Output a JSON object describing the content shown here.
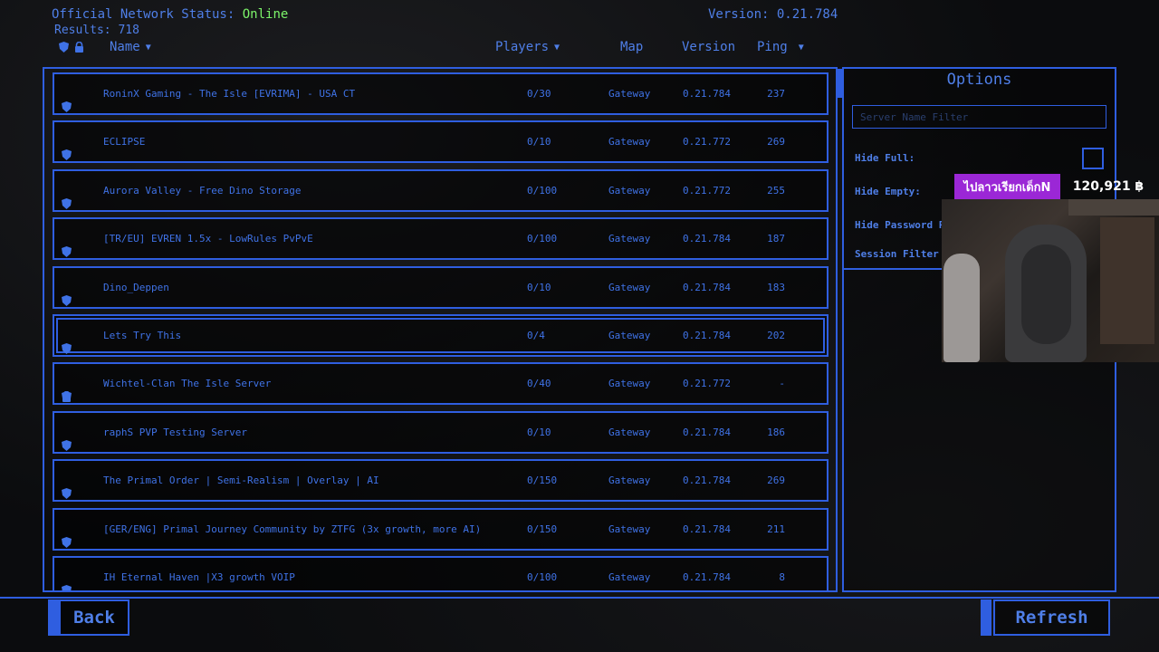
{
  "status": {
    "label": "Official Network Status:",
    "value": "Online",
    "results": "Results: 718",
    "version": "Version: 0.21.784"
  },
  "headers": {
    "name": "Name",
    "players": "Players",
    "map": "Map",
    "version": "Version",
    "ping": "Ping"
  },
  "servers": [
    {
      "name": "RoninX Gaming - The Isle [EVRIMA] - USA CT",
      "players": "0/30",
      "map": "Gateway",
      "version": "0.21.784",
      "ping": "237",
      "locked": false
    },
    {
      "name": "ECLIPSE",
      "players": "0/10",
      "map": "Gateway",
      "version": "0.21.772",
      "ping": "269",
      "locked": false
    },
    {
      "name": "Aurora Valley - Free Dino Storage",
      "players": "0/100",
      "map": "Gateway",
      "version": "0.21.772",
      "ping": "255",
      "locked": false
    },
    {
      "name": "[TR/EU] EVREN 1.5x - LowRules PvPvE",
      "players": "0/100",
      "map": "Gateway",
      "version": "0.21.784",
      "ping": "187",
      "locked": false
    },
    {
      "name": "Dino_Deppen",
      "players": "0/10",
      "map": "Gateway",
      "version": "0.21.784",
      "ping": "183",
      "locked": false
    },
    {
      "name": "Lets Try This",
      "players": "0/4",
      "map": "Gateway",
      "version": "0.21.784",
      "ping": "202",
      "locked": false
    },
    {
      "name": "Wichtel-Clan The Isle Server",
      "players": "0/40",
      "map": "Gateway",
      "version": "0.21.772",
      "ping": "-",
      "locked": true
    },
    {
      "name": "raphS PVP Testing Server",
      "players": "0/10",
      "map": "Gateway",
      "version": "0.21.784",
      "ping": "186",
      "locked": false
    },
    {
      "name": "The Primal Order | Semi-Realism | Overlay | AI",
      "players": "0/150",
      "map": "Gateway",
      "version": "0.21.784",
      "ping": "269",
      "locked": false
    },
    {
      "name": "[GER/ENG] Primal Journey Community by ZTFG (3x growth, more AI)",
      "players": "0/150",
      "map": "Gateway",
      "version": "0.21.784",
      "ping": "211",
      "locked": false
    },
    {
      "name": "IH Eternal Haven |X3 growth VOIP",
      "players": "0/100",
      "map": "Gateway",
      "version": "0.21.784",
      "ping": "8",
      "locked": false
    }
  ],
  "options": {
    "title": "Options",
    "filter_placeholder": "Server Name Filter",
    "hide_full": "Hide Full:",
    "hide_empty": "Hide Empty:",
    "hide_password": "Hide Password P",
    "session_filter": "Session Filter"
  },
  "buttons": {
    "back": "Back",
    "refresh": "Refresh"
  },
  "stream_overlay": {
    "badge": "ไปลาวเรียกเด็กN",
    "amount": "120,921 ฿"
  },
  "colors": {
    "accent": "#2f5ee0",
    "text": "#4f7fe8",
    "online": "#7cf56a",
    "badge": "#9b27d6"
  }
}
